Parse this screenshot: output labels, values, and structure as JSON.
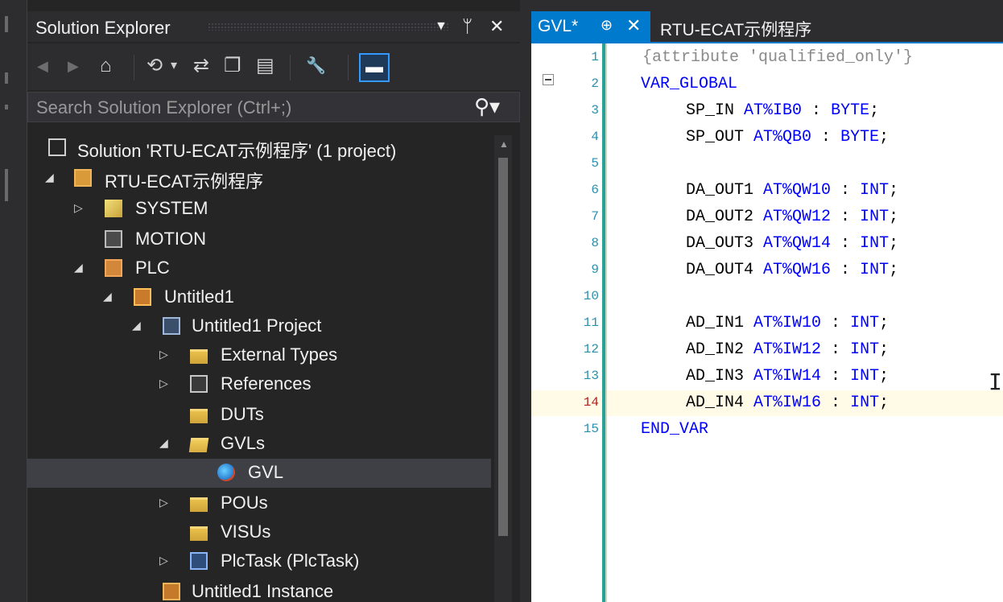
{
  "solution_explorer": {
    "title": "Solution Explorer",
    "title_buttons": {
      "dropdown": "▼",
      "pin": "ᛘ",
      "close": "✕"
    },
    "search_placeholder": "Search Solution Explorer (Ctrl+;)",
    "toolbar": {
      "back": "◀",
      "forward": "▶",
      "home": "⌂",
      "history": "⟲",
      "history_dd": "▾",
      "sync": "⇄",
      "collapse": "❐",
      "show_all": "▤",
      "properties": "🔧",
      "preview": "▬"
    },
    "tree": [
      {
        "id": "solution",
        "label": "Solution 'RTU-ECAT示例程序' (1 project)",
        "level": 0,
        "expander": "",
        "icon": "solution-icon"
      },
      {
        "id": "project",
        "label": "RTU-ECAT示例程序",
        "level": 0,
        "expander": "◢",
        "icon": "project-icon"
      },
      {
        "id": "system",
        "label": "SYSTEM",
        "level": 1,
        "expander": "▷",
        "icon": "system-icon"
      },
      {
        "id": "motion",
        "label": "MOTION",
        "level": 1,
        "expander": "",
        "icon": "motion-icon"
      },
      {
        "id": "plc",
        "label": "PLC",
        "level": 1,
        "expander": "◢",
        "icon": "plc-icon"
      },
      {
        "id": "untitled1",
        "label": "Untitled1",
        "level": 2,
        "expander": "◢",
        "icon": "untitled-icon"
      },
      {
        "id": "untitled1-project",
        "label": "Untitled1 Project",
        "level": 3,
        "expander": "◢",
        "icon": "plc-project-icon"
      },
      {
        "id": "external-types",
        "label": "External Types",
        "level": 4,
        "expander": "▷",
        "icon": "folder-icon"
      },
      {
        "id": "references",
        "label": "References",
        "level": 4,
        "expander": "▷",
        "icon": "references-icon"
      },
      {
        "id": "duts",
        "label": "DUTs",
        "level": 4,
        "expander": "",
        "icon": "folder-icon"
      },
      {
        "id": "gvls",
        "label": "GVLs",
        "level": 4,
        "expander": "◢",
        "icon": "folder-open-icon"
      },
      {
        "id": "gvl",
        "label": "GVL",
        "level": 5,
        "expander": "",
        "icon": "gvl-icon",
        "selected": true
      },
      {
        "id": "pous",
        "label": "POUs",
        "level": 4,
        "expander": "▷",
        "icon": "folder-icon"
      },
      {
        "id": "visus",
        "label": "VISUs",
        "level": 4,
        "expander": "",
        "icon": "folder-icon"
      },
      {
        "id": "plctask",
        "label": "PlcTask (PlcTask)",
        "level": 4,
        "expander": "▷",
        "icon": "task-icon"
      },
      {
        "id": "untitled1-instance",
        "label": "Untitled1 Instance",
        "level": 3,
        "expander": "",
        "icon": "instance-icon"
      }
    ]
  },
  "editor": {
    "tabs": [
      {
        "label": "GVL*",
        "pin": "⊕",
        "close": "✕",
        "active": true
      },
      {
        "label": "RTU-ECAT示例程序",
        "active": false
      }
    ],
    "current_line": 14,
    "lines": [
      {
        "num": "1",
        "name": "{attribute 'qualified_only'}",
        "addr": "",
        "type": "",
        "style": "attr"
      },
      {
        "num": "2",
        "name": "VAR_GLOBAL",
        "addr": "",
        "type": "",
        "style": "kw"
      },
      {
        "num": "3",
        "name": "SP_IN",
        "addr": "AT%IB0",
        "type": "BYTE",
        "style": "decl"
      },
      {
        "num": "4",
        "name": "SP_OUT",
        "addr": "AT%QB0",
        "type": "BYTE",
        "style": "decl"
      },
      {
        "num": "5",
        "name": "",
        "addr": "",
        "type": "",
        "style": "blank"
      },
      {
        "num": "6",
        "name": "DA_OUT1",
        "addr": "AT%QW10",
        "type": "INT",
        "style": "decl"
      },
      {
        "num": "7",
        "name": "DA_OUT2",
        "addr": "AT%QW12",
        "type": "INT",
        "style": "decl"
      },
      {
        "num": "8",
        "name": "DA_OUT3",
        "addr": "AT%QW14",
        "type": "INT",
        "style": "decl"
      },
      {
        "num": "9",
        "name": "DA_OUT4",
        "addr": "AT%QW16",
        "type": "INT",
        "style": "decl"
      },
      {
        "num": "10",
        "name": "",
        "addr": "",
        "type": "",
        "style": "blank"
      },
      {
        "num": "11",
        "name": "AD_IN1",
        "addr": "AT%IW10",
        "type": "INT",
        "style": "decl"
      },
      {
        "num": "12",
        "name": "AD_IN2",
        "addr": "AT%IW12",
        "type": "INT",
        "style": "decl"
      },
      {
        "num": "13",
        "name": "AD_IN3",
        "addr": "AT%IW14",
        "type": "INT",
        "style": "decl"
      },
      {
        "num": "14",
        "name": "AD_IN4",
        "addr": "AT%IW16",
        "type": "INT",
        "style": "decl"
      },
      {
        "num": "15",
        "name": "END_VAR",
        "addr": "",
        "type": "",
        "style": "kw"
      }
    ],
    "colors": {
      "keyword": "#0000ff",
      "attribute": "#8a8a8a",
      "line_number": "#2b91af",
      "current_line_bg": "#fffbe6",
      "accent": "#007acc"
    }
  }
}
